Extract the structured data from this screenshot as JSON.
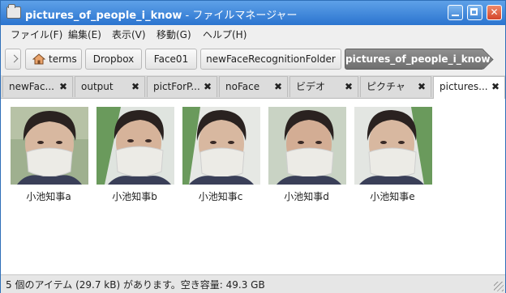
{
  "window": {
    "title_bold": "pictures_of_people_i_know",
    "title_rest": " - ファイルマネージャー"
  },
  "menu": [
    "ファイル(F)",
    "編集(E)",
    "表示(V)",
    "移動(G)",
    "ヘルプ(H)"
  ],
  "path": [
    "terms",
    "Dropbox",
    "Face01",
    "newFaceRecognitionFolder",
    "pictures_of_people_i_know"
  ],
  "tabs": [
    {
      "label": "newFac..."
    },
    {
      "label": "output"
    },
    {
      "label": "pictForP..."
    },
    {
      "label": "noFace"
    },
    {
      "label": "ビデオ"
    },
    {
      "label": "ピクチャ"
    },
    {
      "label": "pictures..."
    }
  ],
  "active_tab": 6,
  "files": [
    {
      "name": "小池知事a"
    },
    {
      "name": "小池知事b"
    },
    {
      "name": "小池知事c"
    },
    {
      "name": "小池知事d"
    },
    {
      "name": "小池知事e"
    }
  ],
  "status": "5 個のアイテム (29.7 kB) があります。空き容量: 49.3 GB",
  "colors": {
    "titlebar": "#3a82d8",
    "active_crumb": "#7a7a7a",
    "close_button": "#d4452a"
  }
}
